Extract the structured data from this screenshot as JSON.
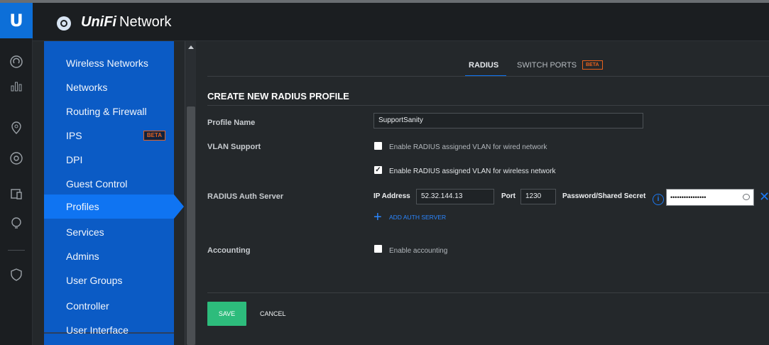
{
  "header": {
    "brand_name": "UniFi",
    "brand_product": "Network"
  },
  "rail": {
    "icons": [
      "dashboard-icon",
      "statistics-icon",
      "map-icon",
      "devices-icon",
      "clients-icon",
      "insights-icon",
      "threat-management-icon"
    ]
  },
  "sidebar": {
    "items": [
      {
        "label": "Wireless Networks"
      },
      {
        "label": "Networks"
      },
      {
        "label": "Routing & Firewall"
      },
      {
        "label": "IPS",
        "badge": "BETA"
      },
      {
        "label": "DPI"
      },
      {
        "label": "Guest Control"
      },
      {
        "label": "Profiles",
        "active": true
      },
      {
        "label": "Services"
      },
      {
        "label": "Admins"
      },
      {
        "label": "User Groups"
      },
      {
        "label": "Controller"
      },
      {
        "label": "User Interface"
      }
    ]
  },
  "tabs": [
    {
      "label": "RADIUS",
      "active": true
    },
    {
      "label": "SWITCH PORTS",
      "badge": "BETA"
    }
  ],
  "form": {
    "title": "CREATE NEW RADIUS PROFILE",
    "profile_name_label": "Profile Name",
    "profile_name_value": "SupportSanity",
    "vlan_label": "VLAN Support",
    "vlan_wired_label": "Enable RADIUS assigned VLAN for wired network",
    "vlan_wired_checked": false,
    "vlan_wireless_label": "Enable RADIUS assigned VLAN for wireless network",
    "vlan_wireless_checked": true,
    "auth_label": "RADIUS Auth Server",
    "ip_label": "IP Address",
    "ip_value": "52.32.144.13",
    "port_label": "Port",
    "port_value": "1230",
    "secret_label": "Password/Shared Secret",
    "secret_value": "••••••••••••••••",
    "add_auth_label": "ADD AUTH SERVER",
    "accounting_label": "Accounting",
    "accounting_checkbox_label": "Enable accounting",
    "accounting_checked": false
  },
  "actions": {
    "save": "SAVE",
    "cancel": "CANCEL"
  },
  "colors": {
    "accent": "#0f74f2",
    "sidebar": "#0b5bc5",
    "save": "#2dbc7c",
    "beta": "#e8621e"
  }
}
